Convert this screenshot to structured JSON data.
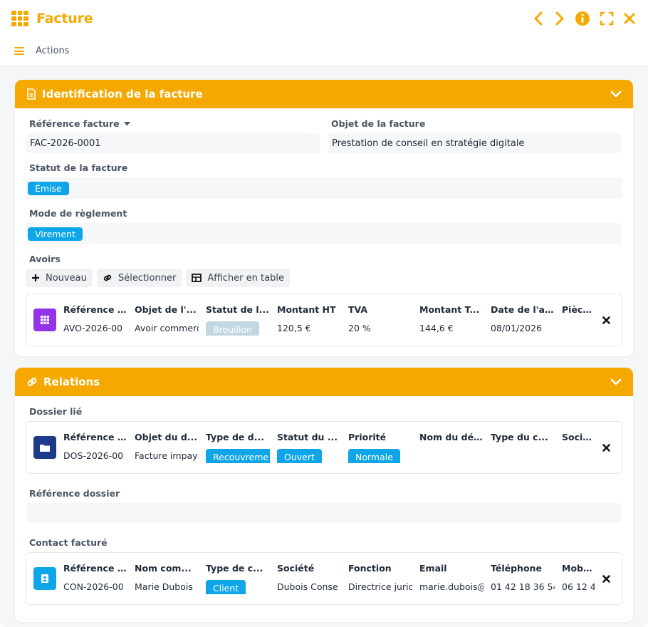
{
  "window": {
    "title": "Facture"
  },
  "actionbar": {
    "label": "Actions"
  },
  "colors": {
    "accent": "#f5a900",
    "badge": "#0ea5e9",
    "badge_draft": "#c3d7e2"
  },
  "section_identification": {
    "title": "Identification de la facture",
    "reference": {
      "label": "Référence facture",
      "value": "FAC-2026-0001"
    },
    "objet": {
      "label": "Objet de la facture",
      "value": "Prestation de conseil en stratégie digitale"
    },
    "statut": {
      "label": "Statut de la facture",
      "value": "Émise"
    },
    "mode": {
      "label": "Mode de règlement",
      "value": "Virement"
    },
    "avoirs": {
      "label": "Avoirs",
      "buttons": {
        "nouveau": "Nouveau",
        "selectionner": "Sélectionner",
        "afficher": "Afficher en table"
      },
      "headers": [
        "Référence ...",
        "Objet de l'...",
        "Statut de l...",
        "Montant HT",
        "TVA",
        "Montant T...",
        "Date de l'a...",
        "Pièce ju"
      ],
      "row": {
        "reference": "AVO-2026-00",
        "objet": "Avoir commerc",
        "statut": "Brouillon",
        "montant_ht": "120,5 €",
        "tva": "20 %",
        "montant_ttc": "144,6 €",
        "date": "08/01/2026",
        "piece": ""
      }
    }
  },
  "section_relations": {
    "title": "Relations",
    "dossier": {
      "label": "Dossier lié",
      "headers": [
        "Référence ...",
        "Objet du d...",
        "Type de d...",
        "Statut du ...",
        "Priorité",
        "Nom du dé...",
        "Type du c...",
        "Sociéte"
      ],
      "row": {
        "reference": "DOS-2026-00",
        "objet": "Facture impay",
        "type": "Recouvreme",
        "statut": "Ouvert",
        "priorite": "Normale",
        "nom": "",
        "type_c": "",
        "societe": ""
      }
    },
    "reference_dossier": {
      "label": "Référence dossier",
      "value": ""
    },
    "contact": {
      "label": "Contact facturé",
      "headers": [
        "Référence ...",
        "Nom com...",
        "Type de c...",
        "Société",
        "Fonction",
        "Email",
        "Téléphone",
        "Mobile"
      ],
      "row": {
        "reference": "CON-2026-00",
        "nom": "Marie Dubois",
        "type": "Client",
        "societe": "Dubois Conse",
        "fonction": "Directrice juric",
        "email": "marie.dubois@",
        "telephone": "01 42 18 36 54",
        "mobile": "06 12 4"
      }
    }
  }
}
